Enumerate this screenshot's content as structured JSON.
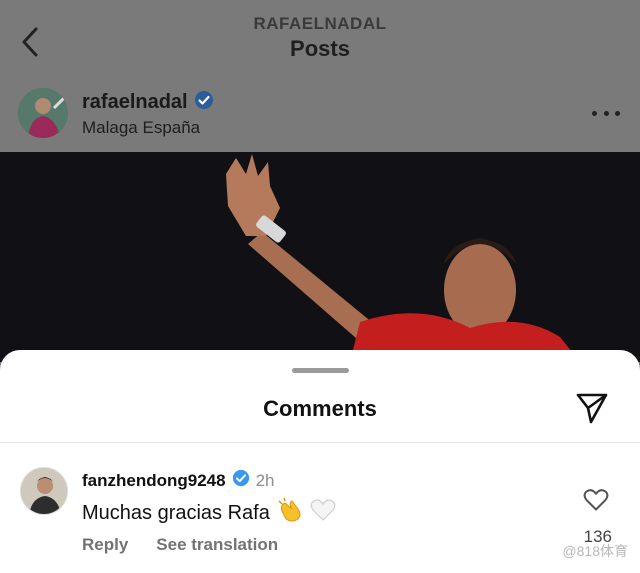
{
  "header": {
    "account": "RAFAELNADAL",
    "title": "Posts",
    "back_icon": "chevron-left-icon"
  },
  "post": {
    "username": "rafaelnadal",
    "verified": true,
    "location": "Malaga España",
    "more_icon": "more-horizontal-icon"
  },
  "comments_sheet": {
    "title": "Comments",
    "share_icon": "send-icon",
    "comments": [
      {
        "username": "fanzhendong9248",
        "verified": true,
        "time": "2h",
        "text": "Muchas gracias Rafa",
        "emojis": [
          "clapping-hands",
          "white-heart"
        ],
        "reply_label": "Reply",
        "translate_label": "See translation",
        "like_count": "136"
      }
    ]
  },
  "watermark": "@818体育",
  "colors": {
    "verified": "#3897f0",
    "overlay": "#777777",
    "sheet": "#ffffff",
    "shirt": "#c41e1e"
  }
}
